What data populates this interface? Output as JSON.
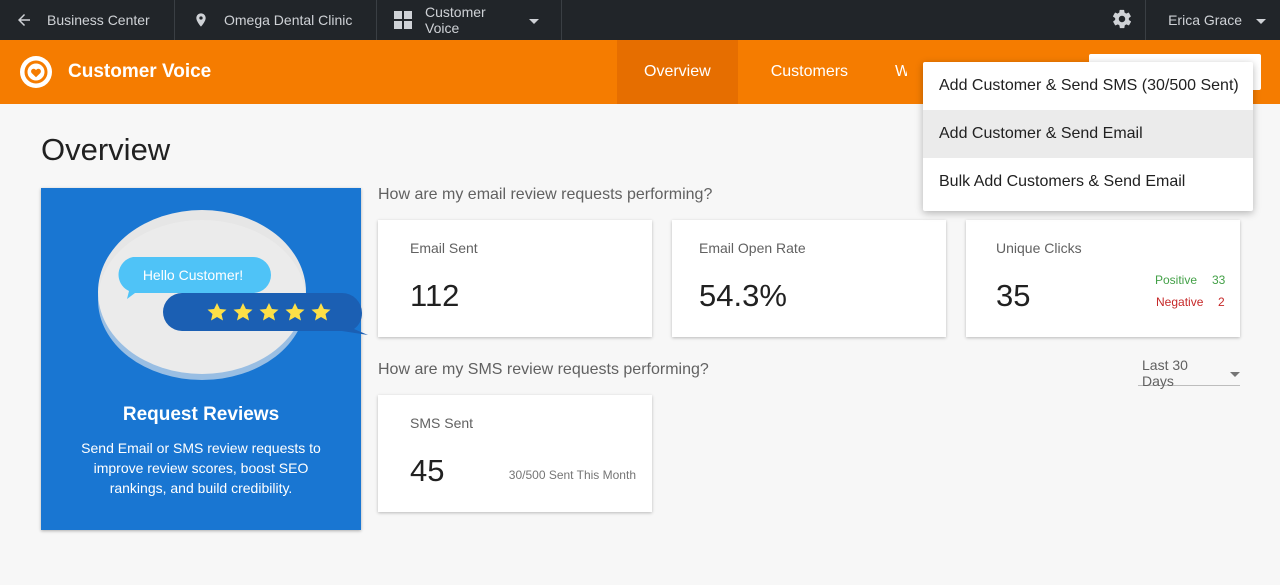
{
  "topbar": {
    "back_label": "Business Center",
    "location_label": "Omega Dental Clinic",
    "product_label": "Customer Voice",
    "user_name": "Erica Grace"
  },
  "appbar": {
    "title": "Customer Voice",
    "nav": [
      {
        "label": "Overview"
      },
      {
        "label": "Customers"
      },
      {
        "label": "Wid"
      }
    ]
  },
  "page": {
    "title": "Overview"
  },
  "promo": {
    "bubble_text": "Hello Customer!",
    "rating": 5,
    "title": "Request Reviews",
    "description": "Send Email or SMS review requests to improve review scores, boost SEO rankings, and build credibility."
  },
  "email_section": {
    "question": "How are my email review requests performing?",
    "cards": [
      {
        "label": "Email Sent",
        "value": "112"
      },
      {
        "label": "Email Open Rate",
        "value": "54.3%"
      },
      {
        "label": "Unique Clicks",
        "value": "35",
        "positive_label": "Positive",
        "positive_value": "33",
        "negative_label": "Negative",
        "negative_value": "2"
      }
    ]
  },
  "sms_section": {
    "question": "How are my SMS review requests performing?",
    "range_select": "Last 30 Days",
    "card": {
      "label": "SMS Sent",
      "value": "45",
      "note": "30/500 Sent This Month"
    }
  },
  "menu": {
    "items": [
      {
        "label": "Add Customer & Send SMS (30/500 Sent)"
      },
      {
        "label": "Add Customer & Send Email"
      },
      {
        "label": "Bulk Add Customers & Send Email"
      }
    ]
  },
  "colors": {
    "accent": "#f57c00",
    "accent_dark": "#e66e00",
    "topbar": "#212529",
    "promo": "#1976d2",
    "positive": "#43a047",
    "negative": "#c62828"
  }
}
